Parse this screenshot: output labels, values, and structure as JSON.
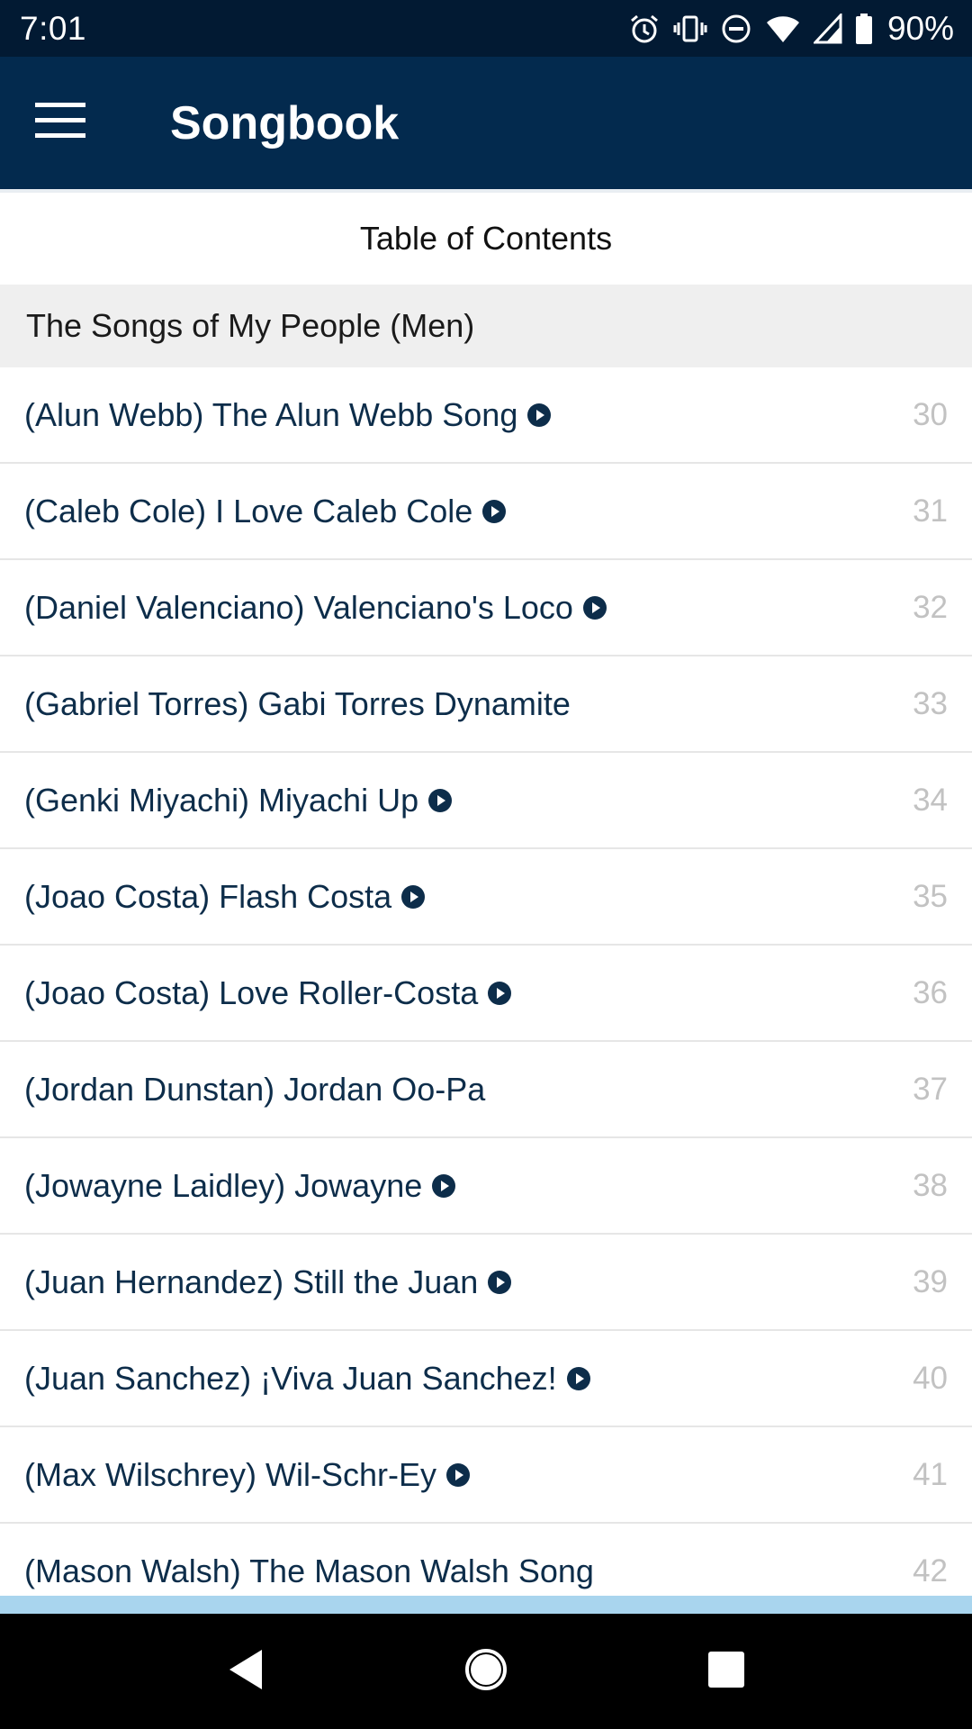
{
  "status": {
    "time": "7:01",
    "battery": "90%",
    "icons": [
      "alarm-icon",
      "vibrate-icon",
      "do-not-disturb-icon",
      "wifi-icon",
      "cell-signal-icon",
      "battery-icon"
    ]
  },
  "app_bar": {
    "title": "Songbook",
    "menu_icon": "hamburger-menu-icon"
  },
  "toc": {
    "title": "Table of Contents"
  },
  "section": {
    "title": "The Songs of My People (Men)"
  },
  "songs": [
    {
      "title": "(Alun Webb) The Alun Webb Song",
      "page": "30",
      "has_audio": true
    },
    {
      "title": "(Caleb Cole) I Love Caleb Cole",
      "page": "31",
      "has_audio": true
    },
    {
      "title": "(Daniel Valenciano) Valenciano's Loco",
      "page": "32",
      "has_audio": true
    },
    {
      "title": "(Gabriel Torres) Gabi Torres Dynamite",
      "page": "33",
      "has_audio": false
    },
    {
      "title": "(Genki Miyachi) Miyachi Up",
      "page": "34",
      "has_audio": true
    },
    {
      "title": "(Joao Costa) Flash Costa",
      "page": "35",
      "has_audio": true
    },
    {
      "title": "(Joao Costa) Love Roller-Costa",
      "page": "36",
      "has_audio": true
    },
    {
      "title": "(Jordan Dunstan) Jordan Oo-Pa",
      "page": "37",
      "has_audio": false
    },
    {
      "title": "(Jowayne Laidley) Jowayne",
      "page": "38",
      "has_audio": true
    },
    {
      "title": "(Juan Hernandez) Still the Juan",
      "page": "39",
      "has_audio": true
    },
    {
      "title": "(Juan Sanchez) ¡Viva Juan Sanchez!",
      "page": "40",
      "has_audio": true
    },
    {
      "title": "(Max Wilschrey) Wil-Schr-Ey",
      "page": "41",
      "has_audio": true
    },
    {
      "title": "(Mason Walsh) The Mason Walsh Song",
      "page": "42",
      "has_audio": false
    }
  ],
  "colors": {
    "app_bar": "#032a4e",
    "status_bar": "#021a33",
    "song_text": "#0d2d4a",
    "page_number": "#c2c2c2",
    "section_bg": "#efefef",
    "accent_strip": "#a9d5ee"
  },
  "nav": {
    "back_icon": "back-triangle-icon",
    "home_icon": "home-circle-icon",
    "recents_icon": "recents-square-icon"
  }
}
